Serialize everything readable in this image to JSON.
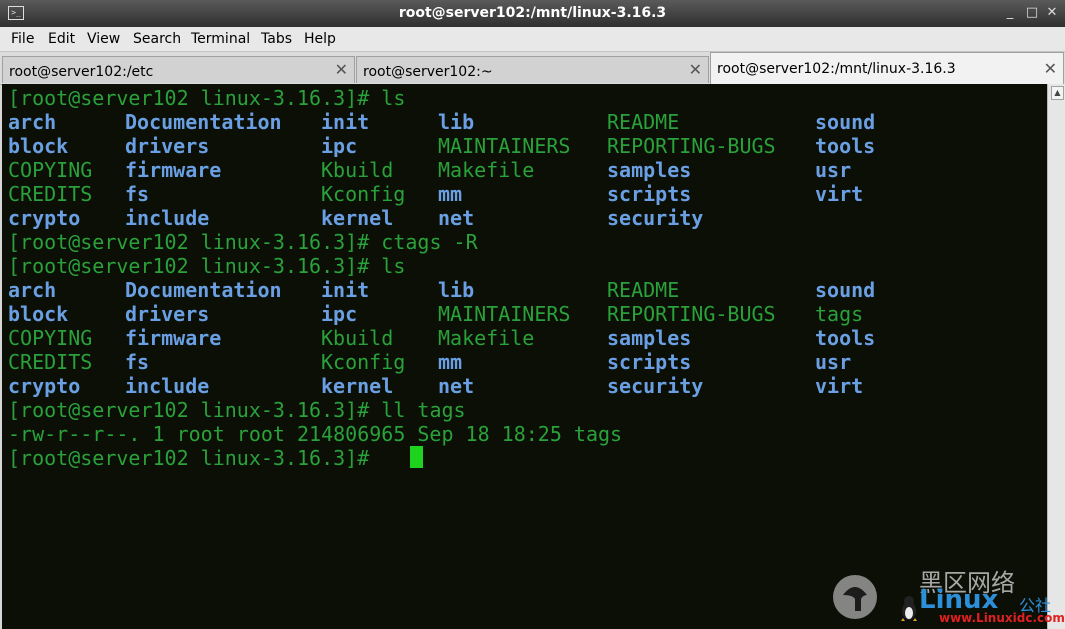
{
  "window": {
    "title": "root@server102:/mnt/linux-3.16.3"
  },
  "window_controls": {
    "minimize": "_",
    "maximize": "□",
    "close": "✕"
  },
  "menu": [
    "File",
    "Edit",
    "View",
    "Search",
    "Terminal",
    "Tabs",
    "Help"
  ],
  "tabs": [
    {
      "label": "root@server102:/etc",
      "active": false
    },
    {
      "label": "root@server102:~",
      "active": false
    },
    {
      "label": "root@server102:/mnt/linux-3.16.3",
      "active": true
    }
  ],
  "terminal": {
    "prompt": "[root@server102 linux-3.16.3]# ",
    "command_1": "ls",
    "listing_1": [
      [
        "arch",
        "Documentation",
        "init",
        "lib",
        "README",
        "sound"
      ],
      [
        "block",
        "drivers",
        "ipc",
        "MAINTAINERS",
        "REPORTING-BUGS",
        "tools"
      ],
      [
        "COPYING",
        "firmware",
        "Kbuild",
        "Makefile",
        "samples",
        "usr"
      ],
      [
        "CREDITS",
        "fs",
        "Kconfig",
        "mm",
        "scripts",
        "virt"
      ],
      [
        "crypto",
        "include",
        "kernel",
        "net",
        "security",
        ""
      ]
    ],
    "command_2": "ctags -R",
    "command_3": "ls",
    "listing_2": [
      [
        "arch",
        "Documentation",
        "init",
        "lib",
        "README",
        "sound"
      ],
      [
        "block",
        "drivers",
        "ipc",
        "MAINTAINERS",
        "REPORTING-BUGS",
        "tags"
      ],
      [
        "COPYING",
        "firmware",
        "Kbuild",
        "Makefile",
        "samples",
        "tools"
      ],
      [
        "CREDITS",
        "fs",
        "Kconfig",
        "mm",
        "scripts",
        "usr"
      ],
      [
        "crypto",
        "include",
        "kernel",
        "net",
        "security",
        "virt"
      ]
    ],
    "command_4": "ll tags",
    "ll_output": "-rw-r--r--. 1 root root 214806965 Sep 18 18:25 tags"
  },
  "watermark": {
    "cn": "黑区网络",
    "brand": "Linux",
    "suffix": "公社",
    "url": "www.Linuxidc.com"
  },
  "colors": {
    "background": "#0b0f06",
    "prompt": "#2aa13a",
    "directory": "#6aa0e3",
    "cursor": "#1ed31e"
  }
}
